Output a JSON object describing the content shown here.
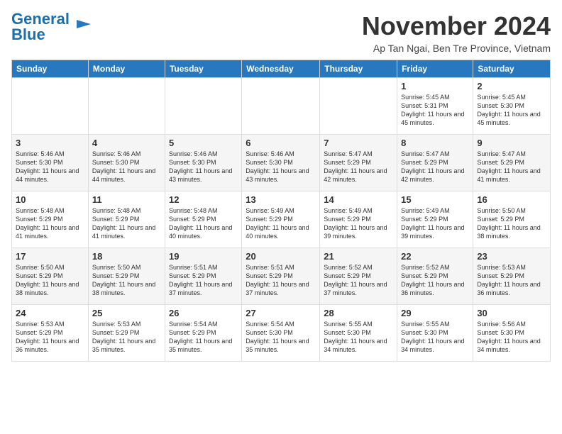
{
  "logo": {
    "part1": "General",
    "part2": "Blue"
  },
  "title": "November 2024",
  "subtitle": "Ap Tan Ngai, Ben Tre Province, Vietnam",
  "headers": [
    "Sunday",
    "Monday",
    "Tuesday",
    "Wednesday",
    "Thursday",
    "Friday",
    "Saturday"
  ],
  "weeks": [
    [
      {
        "day": "",
        "info": ""
      },
      {
        "day": "",
        "info": ""
      },
      {
        "day": "",
        "info": ""
      },
      {
        "day": "",
        "info": ""
      },
      {
        "day": "",
        "info": ""
      },
      {
        "day": "1",
        "info": "Sunrise: 5:45 AM\nSunset: 5:31 PM\nDaylight: 11 hours and 45 minutes."
      },
      {
        "day": "2",
        "info": "Sunrise: 5:45 AM\nSunset: 5:30 PM\nDaylight: 11 hours and 45 minutes."
      }
    ],
    [
      {
        "day": "3",
        "info": "Sunrise: 5:46 AM\nSunset: 5:30 PM\nDaylight: 11 hours and 44 minutes."
      },
      {
        "day": "4",
        "info": "Sunrise: 5:46 AM\nSunset: 5:30 PM\nDaylight: 11 hours and 44 minutes."
      },
      {
        "day": "5",
        "info": "Sunrise: 5:46 AM\nSunset: 5:30 PM\nDaylight: 11 hours and 43 minutes."
      },
      {
        "day": "6",
        "info": "Sunrise: 5:46 AM\nSunset: 5:30 PM\nDaylight: 11 hours and 43 minutes."
      },
      {
        "day": "7",
        "info": "Sunrise: 5:47 AM\nSunset: 5:29 PM\nDaylight: 11 hours and 42 minutes."
      },
      {
        "day": "8",
        "info": "Sunrise: 5:47 AM\nSunset: 5:29 PM\nDaylight: 11 hours and 42 minutes."
      },
      {
        "day": "9",
        "info": "Sunrise: 5:47 AM\nSunset: 5:29 PM\nDaylight: 11 hours and 41 minutes."
      }
    ],
    [
      {
        "day": "10",
        "info": "Sunrise: 5:48 AM\nSunset: 5:29 PM\nDaylight: 11 hours and 41 minutes."
      },
      {
        "day": "11",
        "info": "Sunrise: 5:48 AM\nSunset: 5:29 PM\nDaylight: 11 hours and 41 minutes."
      },
      {
        "day": "12",
        "info": "Sunrise: 5:48 AM\nSunset: 5:29 PM\nDaylight: 11 hours and 40 minutes."
      },
      {
        "day": "13",
        "info": "Sunrise: 5:49 AM\nSunset: 5:29 PM\nDaylight: 11 hours and 40 minutes."
      },
      {
        "day": "14",
        "info": "Sunrise: 5:49 AM\nSunset: 5:29 PM\nDaylight: 11 hours and 39 minutes."
      },
      {
        "day": "15",
        "info": "Sunrise: 5:49 AM\nSunset: 5:29 PM\nDaylight: 11 hours and 39 minutes."
      },
      {
        "day": "16",
        "info": "Sunrise: 5:50 AM\nSunset: 5:29 PM\nDaylight: 11 hours and 38 minutes."
      }
    ],
    [
      {
        "day": "17",
        "info": "Sunrise: 5:50 AM\nSunset: 5:29 PM\nDaylight: 11 hours and 38 minutes."
      },
      {
        "day": "18",
        "info": "Sunrise: 5:50 AM\nSunset: 5:29 PM\nDaylight: 11 hours and 38 minutes."
      },
      {
        "day": "19",
        "info": "Sunrise: 5:51 AM\nSunset: 5:29 PM\nDaylight: 11 hours and 37 minutes."
      },
      {
        "day": "20",
        "info": "Sunrise: 5:51 AM\nSunset: 5:29 PM\nDaylight: 11 hours and 37 minutes."
      },
      {
        "day": "21",
        "info": "Sunrise: 5:52 AM\nSunset: 5:29 PM\nDaylight: 11 hours and 37 minutes."
      },
      {
        "day": "22",
        "info": "Sunrise: 5:52 AM\nSunset: 5:29 PM\nDaylight: 11 hours and 36 minutes."
      },
      {
        "day": "23",
        "info": "Sunrise: 5:53 AM\nSunset: 5:29 PM\nDaylight: 11 hours and 36 minutes."
      }
    ],
    [
      {
        "day": "24",
        "info": "Sunrise: 5:53 AM\nSunset: 5:29 PM\nDaylight: 11 hours and 36 minutes."
      },
      {
        "day": "25",
        "info": "Sunrise: 5:53 AM\nSunset: 5:29 PM\nDaylight: 11 hours and 35 minutes."
      },
      {
        "day": "26",
        "info": "Sunrise: 5:54 AM\nSunset: 5:29 PM\nDaylight: 11 hours and 35 minutes."
      },
      {
        "day": "27",
        "info": "Sunrise: 5:54 AM\nSunset: 5:30 PM\nDaylight: 11 hours and 35 minutes."
      },
      {
        "day": "28",
        "info": "Sunrise: 5:55 AM\nSunset: 5:30 PM\nDaylight: 11 hours and 34 minutes."
      },
      {
        "day": "29",
        "info": "Sunrise: 5:55 AM\nSunset: 5:30 PM\nDaylight: 11 hours and 34 minutes."
      },
      {
        "day": "30",
        "info": "Sunrise: 5:56 AM\nSunset: 5:30 PM\nDaylight: 11 hours and 34 minutes."
      }
    ]
  ]
}
